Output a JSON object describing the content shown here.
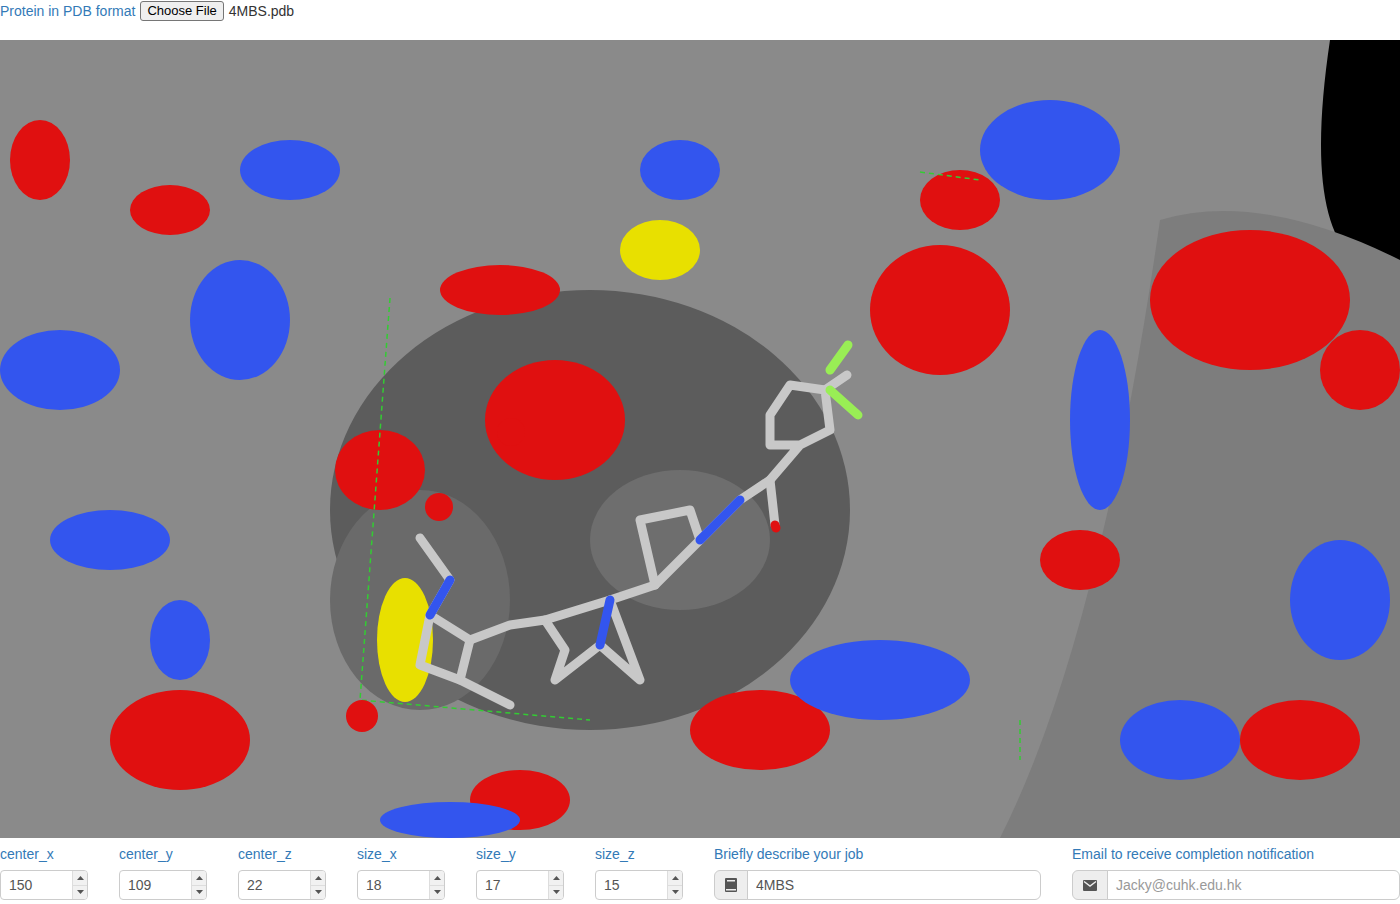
{
  "file_input": {
    "label": "Protein in PDB format",
    "button": "Choose File",
    "filename": "4MBS.pdb"
  },
  "box_fields": [
    {
      "label": "center_x",
      "value": "150"
    },
    {
      "label": "center_y",
      "value": "109"
    },
    {
      "label": "center_z",
      "value": "22"
    },
    {
      "label": "size_x",
      "value": "18"
    },
    {
      "label": "size_y",
      "value": "17"
    },
    {
      "label": "size_z",
      "value": "15"
    }
  ],
  "description": {
    "label": "Briefly describe your job",
    "value": "4MBS"
  },
  "email": {
    "label": "Email to receive completion notification",
    "placeholder": "Jacky@cuhk.edu.hk"
  }
}
